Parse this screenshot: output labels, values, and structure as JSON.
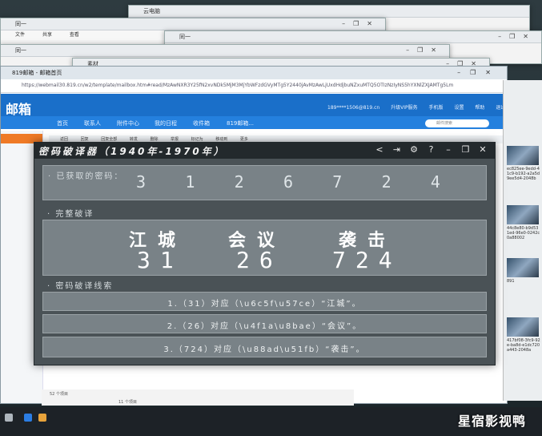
{
  "background": {
    "windows": [
      {
        "title": "云电脑"
      },
      {
        "title": "同一"
      },
      {
        "title": "同一"
      },
      {
        "title": "同一"
      },
      {
        "title": "素材"
      }
    ],
    "ribbon": [
      "文件",
      "共享",
      "查看"
    ]
  },
  "browser": {
    "tab_title": "819邮箱 - 邮箱首页",
    "url": "https://webmail30.819.cn/w2/template/mailbox.htm#read/MzAwNXR3Y25fN2xvNDk5MjM3MjYbWFzdGVyMTg5Y2440jAvMzAwLjUxdHdjbuNZxuMTQ5OTIzNzIyNS5hYXNlZXJAMTg5Lm",
    "logo": "邮箱",
    "user": "189****1506@819.cn",
    "user_links": [
      "升级VIP服务",
      "手机版",
      "设置",
      "帮助",
      "退出"
    ],
    "nav": [
      "首页",
      "联系人",
      "附件中心",
      "我的日程",
      "收件箱",
      "819邮箱..."
    ],
    "search_placeholder": "邮件搜索",
    "subtoolbar": [
      "返回",
      "回复",
      "回复全部",
      "转发",
      "删除",
      "举报",
      "标记为",
      "移动到",
      "更多"
    ],
    "status": [
      "52 个项目",
      "11 个项目"
    ]
  },
  "right_panel": [
    {
      "text": "ec825ee-9edd-41c9-b192-a2a5d9ee5d4-2048b"
    },
    {
      "text": "44c8e80-b9d531ed-96e0-0242c0a88002"
    },
    {
      "text": "891"
    },
    {
      "text": "417bf08-3fc9-92e-ba8d-e1dc720a443-2048a"
    }
  ],
  "tool": {
    "title": "密码破译器（1940年-1970年）",
    "icons": [
      "minimize-to-tray-icon",
      "logout-icon",
      "gear-icon",
      "help-icon",
      "minimize-icon",
      "restore-icon",
      "close-icon"
    ],
    "icon_glyphs": [
      "<",
      "⇥",
      "⚙",
      "?",
      "–",
      "❐",
      "✕"
    ],
    "obtained_label": "· 已获取的密码：",
    "digits": [
      "3",
      "1",
      "2",
      "6",
      "7",
      "2",
      "4"
    ],
    "complete_label": "· 完整破译",
    "decoded": [
      {
        "word": "江城",
        "code": "31"
      },
      {
        "word": "会议",
        "code": "26"
      },
      {
        "word": "袭击",
        "code": "724"
      }
    ],
    "clues_label": "· 密码破译线索",
    "clues": [
      "1.（31）对应（\\u6c5f\\u57ce）“江城”。",
      "2.（26）对应（\\u4f1a\\u8bae）“会议”。",
      "3.（724）对应（\\u88ad\\u51fb）“袭击”。"
    ]
  },
  "watermark": "星宿影视鸭"
}
